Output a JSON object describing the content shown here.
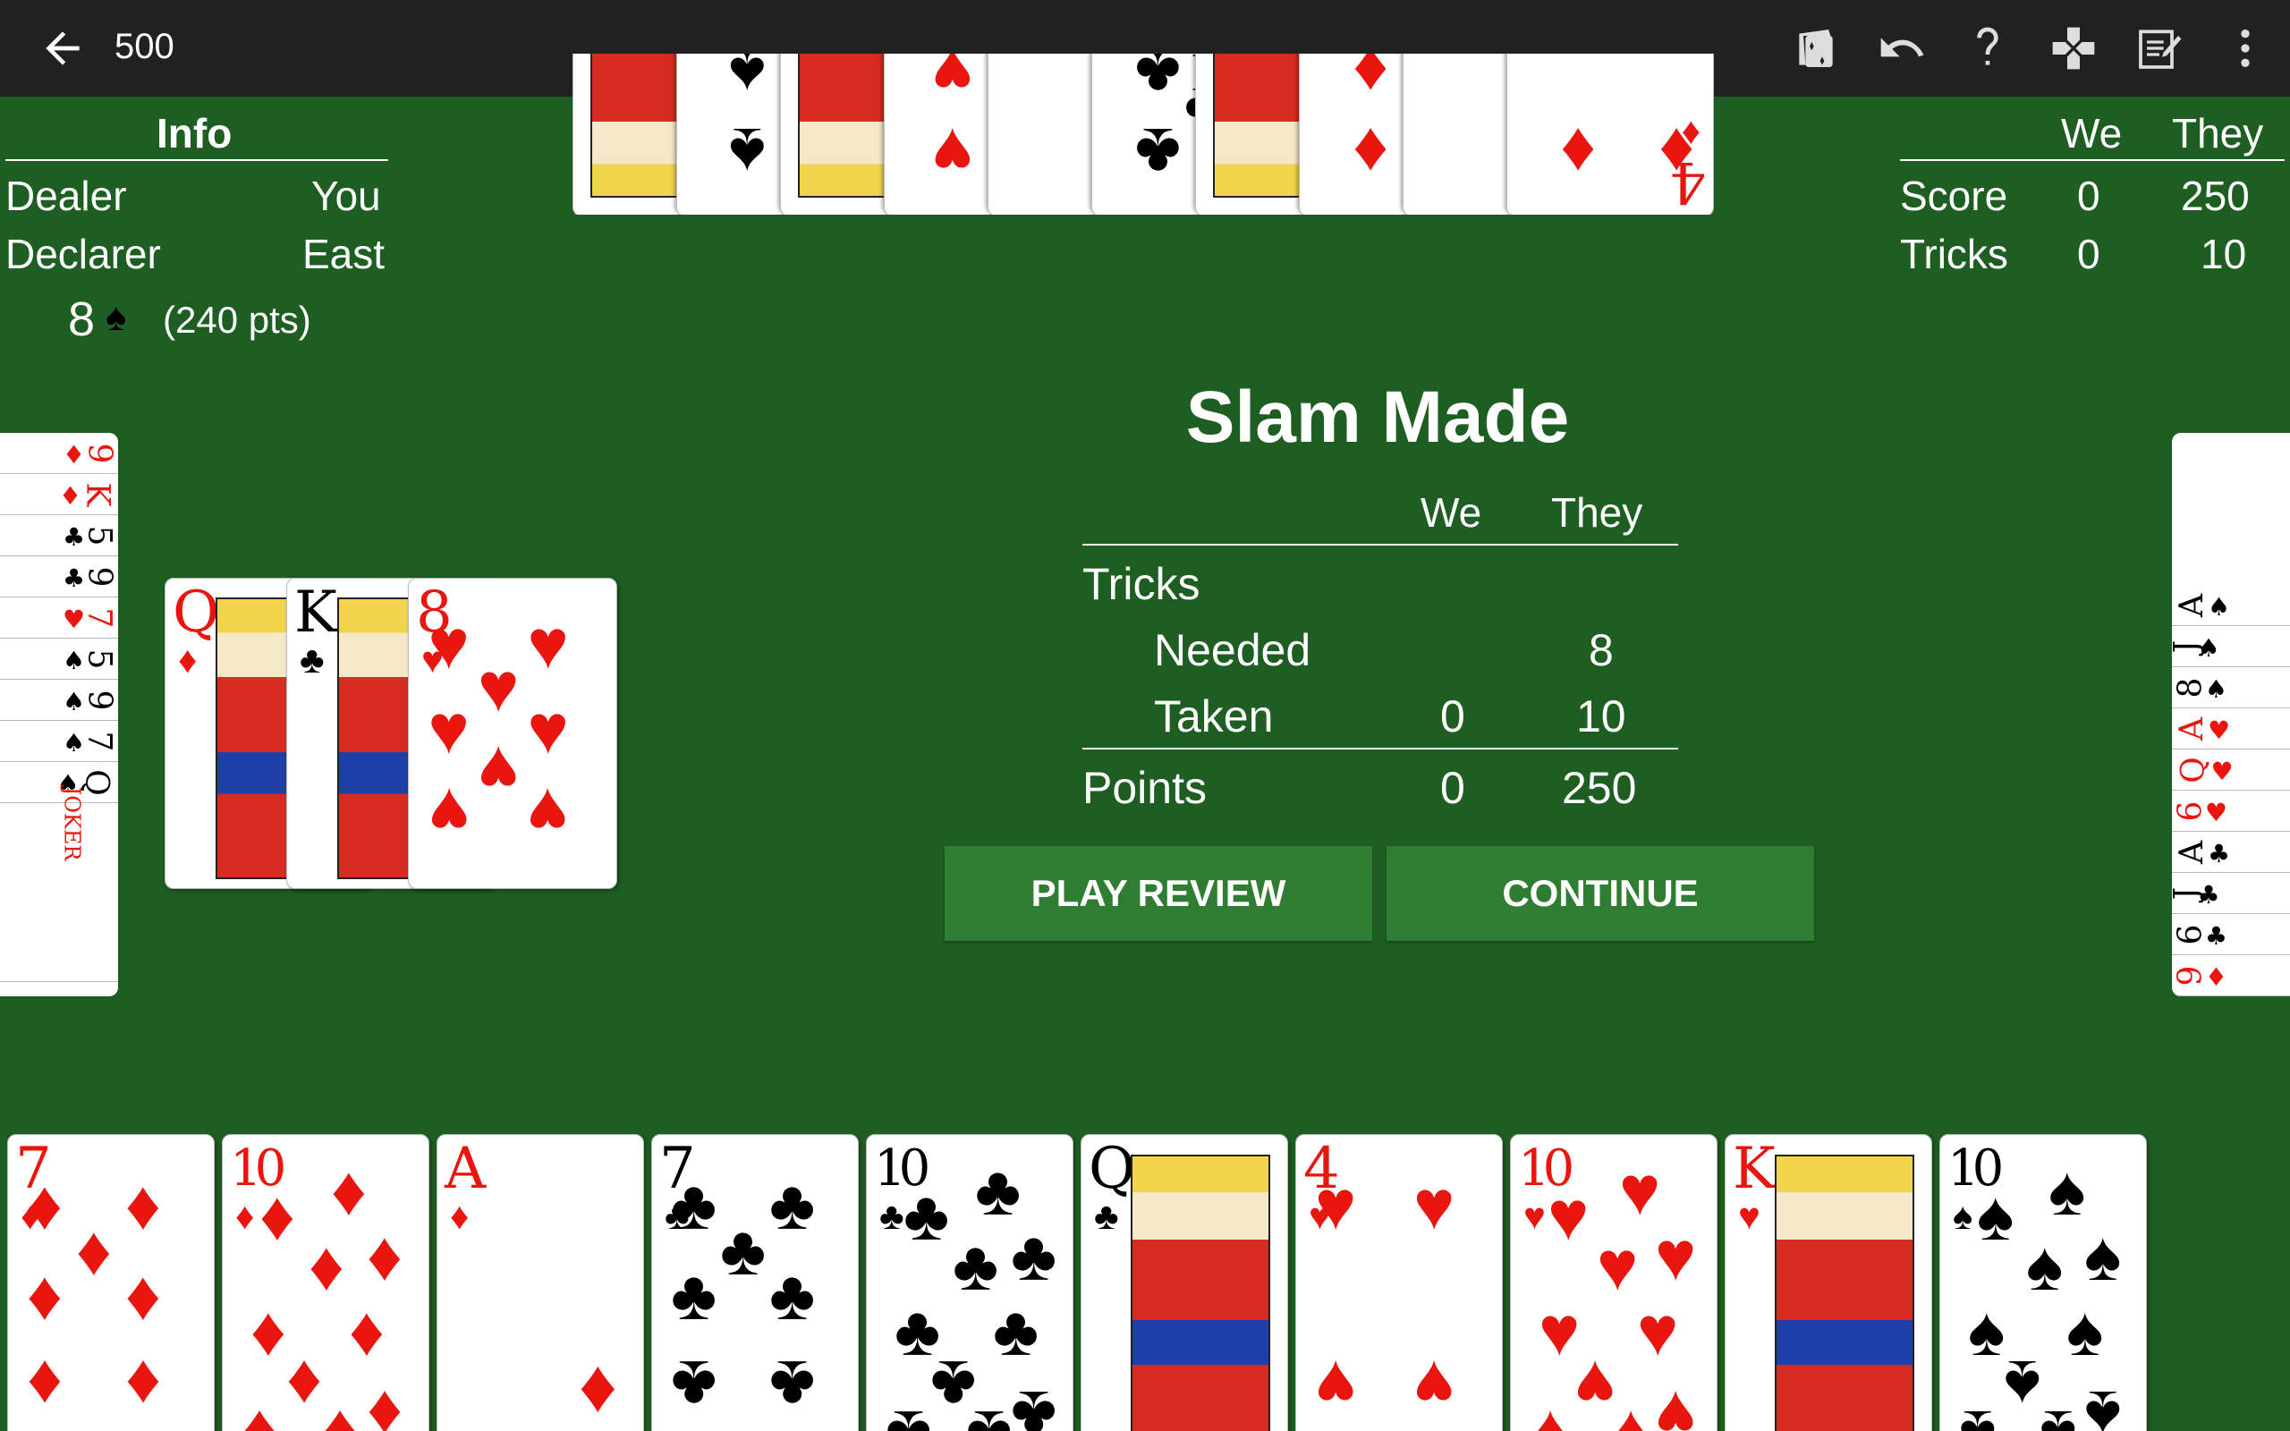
{
  "app": {
    "title": "500"
  },
  "toolbar": {
    "icons": [
      "back-arrow-icon",
      "cards-icon",
      "undo-icon",
      "help-icon",
      "gamepad-icon",
      "notepad-icon",
      "more-vert-icon"
    ]
  },
  "info": {
    "heading": "Info",
    "dealer_label": "Dealer",
    "dealer_value": "You",
    "declarer_label": "Declarer",
    "declarer_value": "East",
    "bid_number": "8",
    "bid_suit": "♠",
    "bid_points": "(240 pts)"
  },
  "scoreboard": {
    "col_we": "We",
    "col_they": "They",
    "score_label": "Score",
    "score_we": "0",
    "score_they": "250",
    "tricks_label": "Tricks",
    "tricks_we": "0",
    "tricks_they": "10"
  },
  "result": {
    "title": "Slam Made",
    "col_we": "We",
    "col_they": "They",
    "tricks_label": "Tricks",
    "needed_label": "Needed",
    "needed_we": "",
    "needed_they": "8",
    "taken_label": "Taken",
    "taken_we": "0",
    "taken_they": "10",
    "points_label": "Points",
    "points_we": "0",
    "points_they": "250",
    "play_review_label": "PLAY REVIEW",
    "continue_label": "CONTINUE"
  },
  "north_hand": [
    {
      "rank": "K",
      "suit": "♠"
    },
    {
      "rank": "6",
      "suit": "♠"
    },
    {
      "rank": "J",
      "suit": "♥"
    },
    {
      "rank": "6",
      "suit": "♥"
    },
    {
      "rank": "5",
      "suit": "♥"
    },
    {
      "rank": "8",
      "suit": "♣"
    },
    {
      "rank": "J",
      "suit": "♦"
    },
    {
      "rank": "8",
      "suit": "♦"
    },
    {
      "rank": "5",
      "suit": "♦"
    },
    {
      "rank": "4",
      "suit": "♦"
    }
  ],
  "west_hand": [
    {
      "rank": "9",
      "suit": "♦"
    },
    {
      "rank": "K",
      "suit": "♦"
    },
    {
      "rank": "5",
      "suit": "♣"
    },
    {
      "rank": "9",
      "suit": "♣"
    },
    {
      "rank": "7",
      "suit": "♥"
    },
    {
      "rank": "5",
      "suit": "♠"
    },
    {
      "rank": "9",
      "suit": "♠"
    },
    {
      "rank": "7",
      "suit": "♠"
    },
    {
      "rank": "Q",
      "suit": "♠"
    },
    {
      "rank": "JOKER",
      "suit": ""
    }
  ],
  "east_hand": [
    {
      "rank": "A",
      "suit": "♠"
    },
    {
      "rank": "J",
      "suit": "♠"
    },
    {
      "rank": "8",
      "suit": "♠"
    },
    {
      "rank": "A",
      "suit": "♥"
    },
    {
      "rank": "Q",
      "suit": "♥"
    },
    {
      "rank": "6",
      "suit": "♥"
    },
    {
      "rank": "A",
      "suit": "♣"
    },
    {
      "rank": "J",
      "suit": "♣"
    },
    {
      "rank": "6",
      "suit": "♣"
    },
    {
      "rank": "9",
      "suit": "♦"
    }
  ],
  "trick": [
    {
      "rank": "Q",
      "suit": "♦"
    },
    {
      "rank": "K",
      "suit": "♣"
    },
    {
      "rank": "8",
      "suit": "♥"
    }
  ],
  "south_hand": [
    {
      "rank": "7",
      "suit": "♦"
    },
    {
      "rank": "10",
      "suit": "♦"
    },
    {
      "rank": "A",
      "suit": "♦"
    },
    {
      "rank": "7",
      "suit": "♣"
    },
    {
      "rank": "10",
      "suit": "♣"
    },
    {
      "rank": "Q",
      "suit": "♣"
    },
    {
      "rank": "4",
      "suit": "♥"
    },
    {
      "rank": "10",
      "suit": "♥"
    },
    {
      "rank": "K",
      "suit": "♥"
    },
    {
      "rank": "10",
      "suit": "♠"
    }
  ],
  "colors": {
    "felt": "#1e5e22",
    "toolbar": "#212121",
    "button": "#2e7d32",
    "red_suit": "#e8160e"
  }
}
